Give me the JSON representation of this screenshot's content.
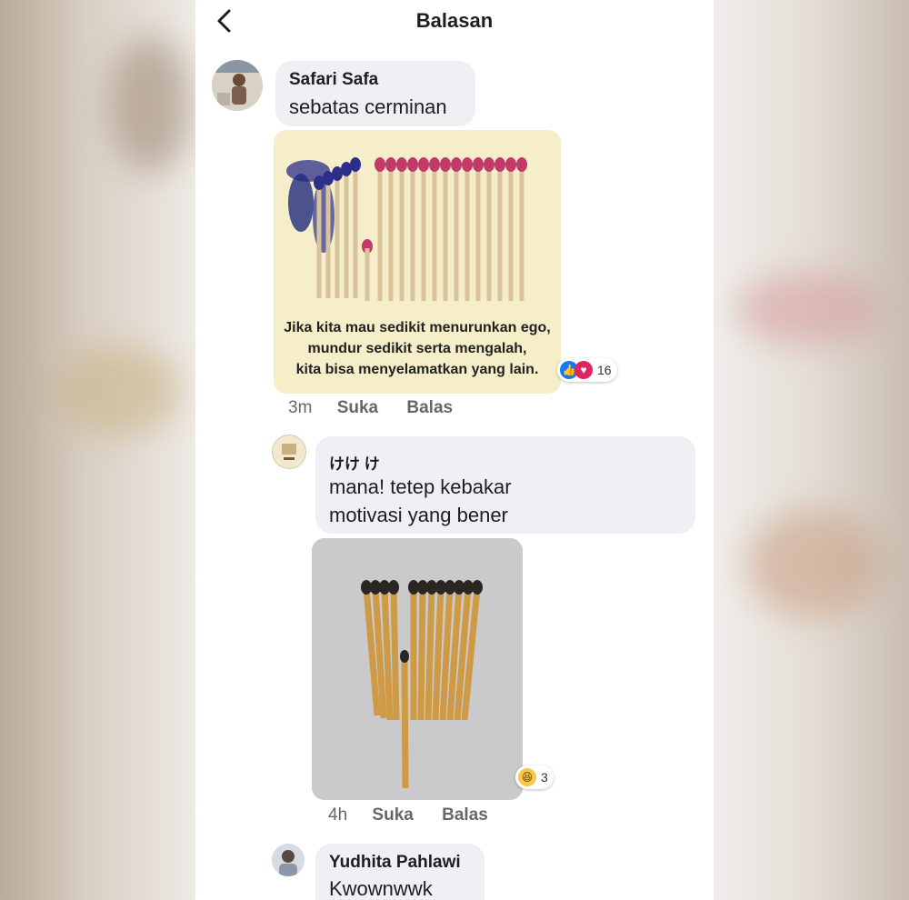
{
  "header": {
    "title": "Balasan",
    "back_icon": "arrow-left-icon"
  },
  "comments": [
    {
      "author": "Safari Safa",
      "text": "sebatas cerminan",
      "image_caption": [
        "Jika kita mau sedikit menurunkan ego,",
        "mundur sedikit serta mengalah,",
        "kita bisa menyelamatkan yang lain."
      ],
      "reaction_count": "16",
      "reactions": [
        "like-icon",
        "love-icon"
      ],
      "time": "3m",
      "like_label": "Suka",
      "reply_label": "Balas"
    },
    {
      "author": "けけ け",
      "text_lines": [
        "mana! tetep kebakar",
        "motivasi yang bener"
      ],
      "reaction_count": "3",
      "reactions": [
        "haha-icon"
      ],
      "time": "4h",
      "like_label": "Suka",
      "reply_label": "Balas"
    },
    {
      "author": "Yudhita Pahlawi",
      "text": "Kwownwwk"
    }
  ],
  "colors": {
    "bubble": "#eef0f4",
    "meta": "#65676b",
    "like": "#1877f2",
    "love": "#e0245e"
  }
}
